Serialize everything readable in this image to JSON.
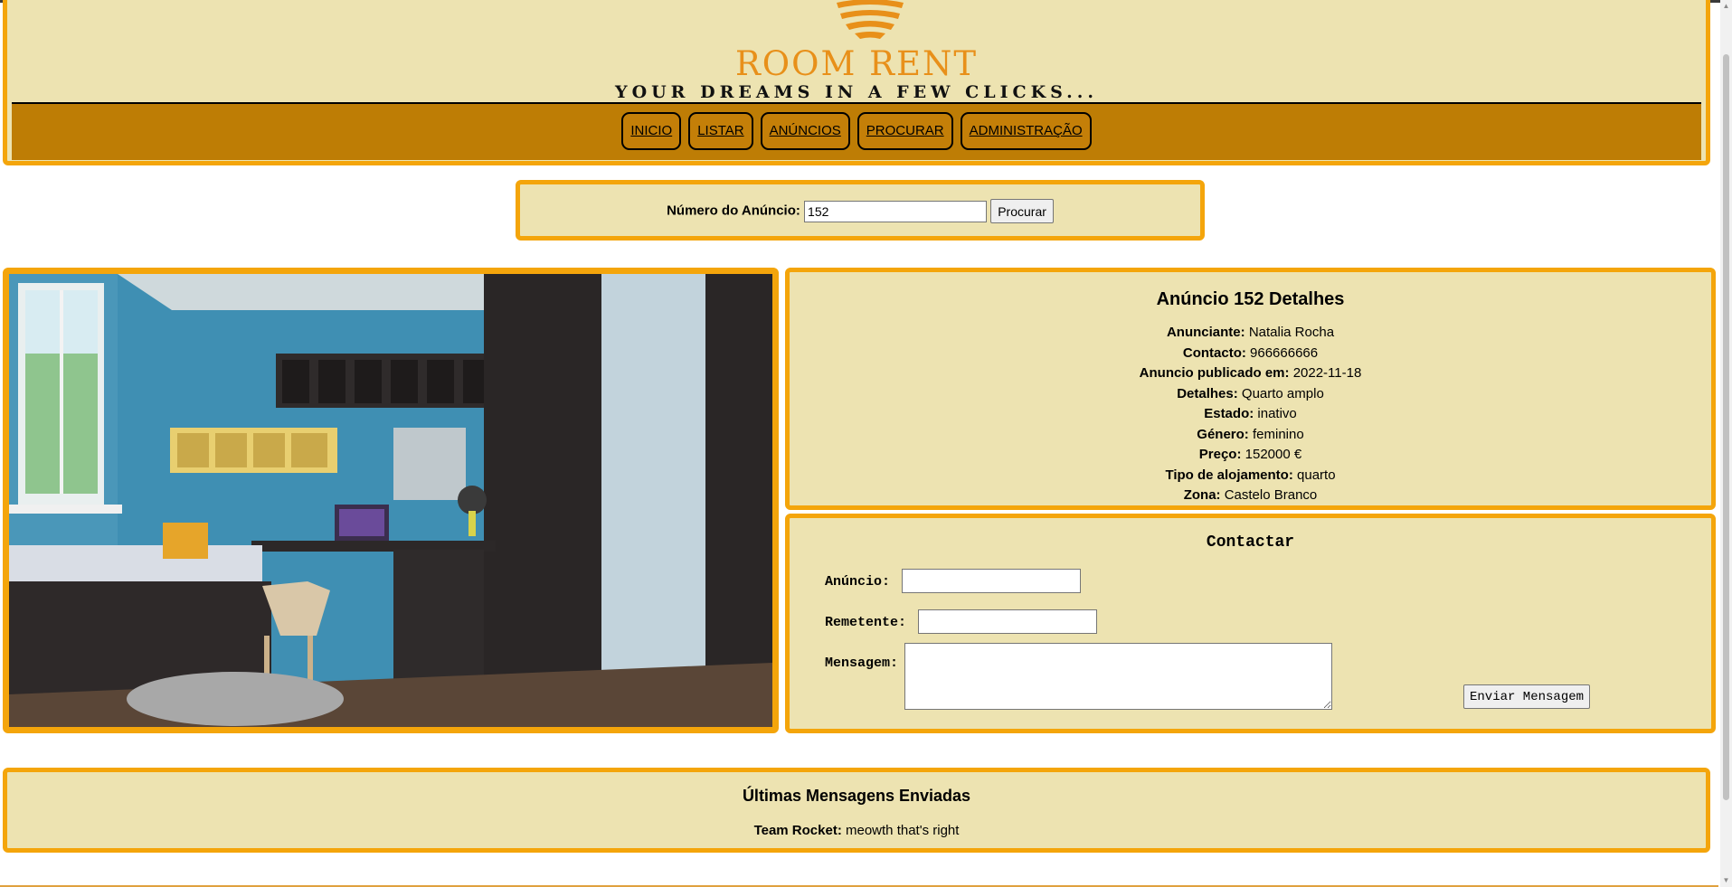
{
  "brand": {
    "name": "ROOM RENT",
    "tagline": "YOUR DREAMS IN A FEW CLICKS..."
  },
  "nav": {
    "items": [
      "INICIO",
      "LISTAR",
      "ANÚNCIOS",
      "PROCURAR",
      "ADMINISTRAÇÃO"
    ]
  },
  "search": {
    "label": "Número do Anúncio:",
    "value": "152",
    "button": "Procurar"
  },
  "details": {
    "title": "Anúncio 152 Detalhes",
    "rows": [
      {
        "label": "Anunciante:",
        "value": "Natalia Rocha"
      },
      {
        "label": "Contacto:",
        "value": "966666666"
      },
      {
        "label": "Anuncio publicado em:",
        "value": "2022-11-18"
      },
      {
        "label": "Detalhes:",
        "value": "Quarto amplo"
      },
      {
        "label": "Estado:",
        "value": "inativo"
      },
      {
        "label": "Género:",
        "value": "feminino"
      },
      {
        "label": "Preço:",
        "value": "152000 €"
      },
      {
        "label": "Tipo de alojamento:",
        "value": "quarto"
      },
      {
        "label": "Zona:",
        "value": "Castelo Branco"
      }
    ]
  },
  "contact": {
    "title": "Contactar",
    "anuncio_label": "Anúncio:",
    "anuncio_value": "",
    "remetente_label": "Remetente:",
    "remetente_value": "",
    "mensagem_label": "Mensagem:",
    "mensagem_value": "",
    "send_button": "Enviar Mensagem"
  },
  "messages": {
    "title": "Últimas Mensagens Enviadas",
    "items": [
      {
        "sender": "Team Rocket:",
        "text": "meowth that's right"
      }
    ]
  },
  "colors": {
    "panel_bg": "#ede3b1",
    "border": "#f4a50b",
    "nav_bg": "#be7d05",
    "brand": "#e8901a"
  }
}
